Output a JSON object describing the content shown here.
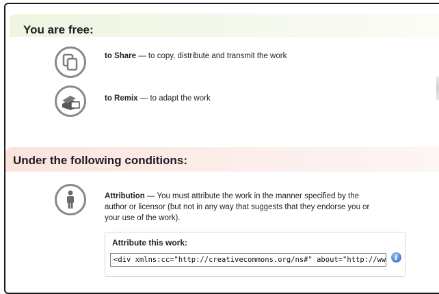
{
  "free": {
    "heading": "You are free:",
    "items": [
      {
        "name": "to Share",
        "desc": " — to copy, distribute and transmit the work",
        "icon": "share-icon"
      },
      {
        "name": "to Remix",
        "desc": " — to adapt the work",
        "icon": "remix-icon"
      }
    ]
  },
  "conditions": {
    "heading": "Under the following conditions:",
    "attribution": {
      "name": "Attribution",
      "line1": " — You must attribute the work in the manner specified by the",
      "line2": "author or licensor (but not in any way that suggests that they endorse you or",
      "line3": "your use of the work).",
      "icon": "attribution-person-icon"
    }
  },
  "attribute_box": {
    "title": "Attribute this work:",
    "code": "<div xmlns:cc=\"http://creativecommons.org/ns#\" about=\"http://www",
    "info_icon": "info-icon"
  },
  "colors": {
    "free_band": "#eef5e1",
    "conditions_band": "#fbe3de",
    "icon_gray": "#8a8a8a"
  }
}
